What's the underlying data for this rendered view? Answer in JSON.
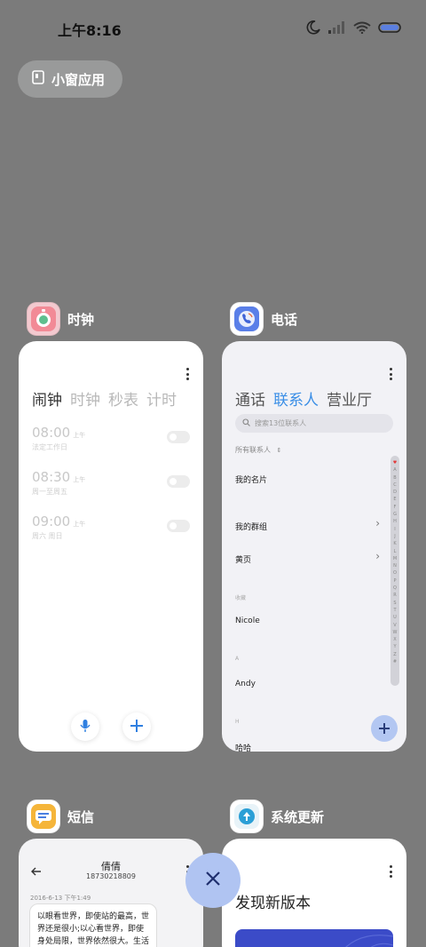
{
  "status_bar": {
    "time": "上午8:16",
    "icons": [
      "moon-icon",
      "signal-icon",
      "wifi-icon",
      "battery-icon"
    ]
  },
  "mini_window_button": {
    "label": "小窗应用"
  },
  "apps": {
    "clock": {
      "name": "时钟",
      "tabs": [
        "闹钟",
        "计时",
        "秒表",
        "计时"
      ],
      "tabs_display": [
        "闹钟",
        "时钟",
        "秒表",
        "计时"
      ],
      "alarms": [
        {
          "time": "08:00",
          "ampm": "上午",
          "repeat": "法定工作日"
        },
        {
          "time": "08:30",
          "ampm": "上午",
          "repeat": "周一至周五"
        },
        {
          "time": "09:00",
          "ampm": "上午",
          "repeat": "周六 周日"
        }
      ]
    },
    "phone": {
      "name": "电话",
      "tabs": [
        "通话",
        "联系人",
        "营业厅"
      ],
      "search_placeholder": "搜索13位联系人",
      "filter": "所有联系人",
      "my_card": "我的名片",
      "my_groups": "我的群组",
      "yellow_pages": "黄页",
      "section_favorites": "收藏",
      "favorite_1": "Nicole",
      "section_a": "A",
      "contact_a": "Andy",
      "section_h": "H",
      "contact_h": "哈哈",
      "index_letters": [
        "♥",
        "A",
        "B",
        "C",
        "D",
        "E",
        "F",
        "G",
        "H",
        "I",
        "J",
        "K",
        "L",
        "M",
        "N",
        "O",
        "P",
        "Q",
        "R",
        "S",
        "T",
        "U",
        "V",
        "W",
        "X",
        "Y",
        "Z",
        "#"
      ]
    },
    "sms": {
      "name": "短信",
      "contact": "倩倩",
      "number": "18730218809",
      "date": "2016-6-13 下午1:49",
      "message": "以眼看世界，即使站的最高，世界还是很小;以心看世界，即使身处局限，世界依然很大。生活远不完"
    },
    "update": {
      "name": "系统更新",
      "title": "发现新版本"
    }
  },
  "colors": {
    "background": "#7b7b7b",
    "accent": "#3a8ee6",
    "fab": "#b0c4f2"
  }
}
